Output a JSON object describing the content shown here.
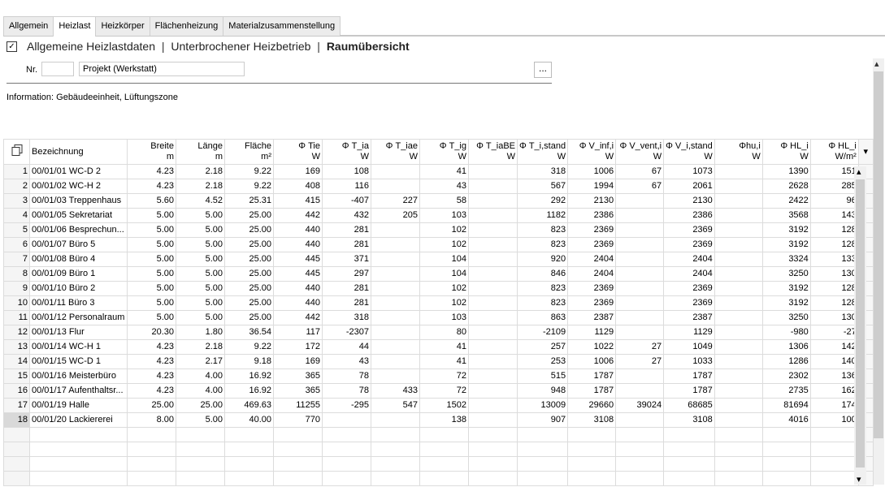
{
  "tabs": [
    {
      "label": "Allgemein",
      "active": false
    },
    {
      "label": "Heizlast",
      "active": true
    },
    {
      "label": "Heizkörper",
      "active": false
    },
    {
      "label": "Flächenheizung",
      "active": false
    },
    {
      "label": "Materialzusammenstellung",
      "active": false
    }
  ],
  "breadcrumb": {
    "item1": "Allgemeine Heizlastdaten",
    "item2": "Unterbrochener Heizbetrieb",
    "current": "Raumübersicht",
    "separator": "|",
    "checkbox": "✓"
  },
  "form": {
    "nr_label": "Nr.",
    "nr_value": "",
    "project_value": "Projekt (Werkstatt)",
    "dots_label": "..."
  },
  "info": "Information: Gebäudeeinheit, Lüftungszone",
  "icons": {
    "copy": "copy-icon",
    "scroll_up": "▴",
    "scroll_down": "▾",
    "menu_down": "▾"
  },
  "table": {
    "columns": [
      {
        "label": "Bezeichnung",
        "unit": ""
      },
      {
        "label": "Breite",
        "unit": "m"
      },
      {
        "label": "Länge",
        "unit": "m"
      },
      {
        "label": "Fläche",
        "unit": "m²"
      },
      {
        "label": "Φ Tie",
        "unit": "W"
      },
      {
        "label": "Φ T_ia",
        "unit": "W"
      },
      {
        "label": "Φ T_iae",
        "unit": "W"
      },
      {
        "label": "Φ T_ig",
        "unit": "W"
      },
      {
        "label": "Φ T_iaBE",
        "unit": "W"
      },
      {
        "label": "Φ T_i,stand",
        "unit": "W"
      },
      {
        "label": "Φ V_inf,i",
        "unit": "W"
      },
      {
        "label": "Φ V_vent,i",
        "unit": "W"
      },
      {
        "label": "Φ V_i,stand",
        "unit": "W"
      },
      {
        "label": "Φhu,i",
        "unit": "W"
      },
      {
        "label": "Φ HL_i",
        "unit": "W"
      },
      {
        "label": "Φ HL_i",
        "unit": "W/m²"
      }
    ],
    "rows": [
      [
        "1",
        "00/01/01 WC-D 2",
        "4.23",
        "2.18",
        "9.22",
        "169",
        "108",
        "",
        "41",
        "",
        "318",
        "1006",
        "67",
        "1073",
        "",
        "1390",
        "151"
      ],
      [
        "2",
        "00/01/02 WC-H 2",
        "4.23",
        "2.18",
        "9.22",
        "408",
        "116",
        "",
        "43",
        "",
        "567",
        "1994",
        "67",
        "2061",
        "",
        "2628",
        "285"
      ],
      [
        "3",
        "00/01/03 Treppenhaus",
        "5.60",
        "4.52",
        "25.31",
        "415",
        "-407",
        "227",
        "58",
        "",
        "292",
        "2130",
        "",
        "2130",
        "",
        "2422",
        "96"
      ],
      [
        "4",
        "00/01/05 Sekretariat",
        "5.00",
        "5.00",
        "25.00",
        "442",
        "432",
        "205",
        "103",
        "",
        "1182",
        "2386",
        "",
        "2386",
        "",
        "3568",
        "143"
      ],
      [
        "5",
        "00/01/06 Besprechun...",
        "5.00",
        "5.00",
        "25.00",
        "440",
        "281",
        "",
        "102",
        "",
        "823",
        "2369",
        "",
        "2369",
        "",
        "3192",
        "128"
      ],
      [
        "6",
        "00/01/07 Büro 5",
        "5.00",
        "5.00",
        "25.00",
        "440",
        "281",
        "",
        "102",
        "",
        "823",
        "2369",
        "",
        "2369",
        "",
        "3192",
        "128"
      ],
      [
        "7",
        "00/01/08 Büro 4",
        "5.00",
        "5.00",
        "25.00",
        "445",
        "371",
        "",
        "104",
        "",
        "920",
        "2404",
        "",
        "2404",
        "",
        "3324",
        "133"
      ],
      [
        "8",
        "00/01/09 Büro 1",
        "5.00",
        "5.00",
        "25.00",
        "445",
        "297",
        "",
        "104",
        "",
        "846",
        "2404",
        "",
        "2404",
        "",
        "3250",
        "130"
      ],
      [
        "9",
        "00/01/10 Büro 2",
        "5.00",
        "5.00",
        "25.00",
        "440",
        "281",
        "",
        "102",
        "",
        "823",
        "2369",
        "",
        "2369",
        "",
        "3192",
        "128"
      ],
      [
        "10",
        "00/01/11 Büro 3",
        "5.00",
        "5.00",
        "25.00",
        "440",
        "281",
        "",
        "102",
        "",
        "823",
        "2369",
        "",
        "2369",
        "",
        "3192",
        "128"
      ],
      [
        "11",
        "00/01/12 Personalraum",
        "5.00",
        "5.00",
        "25.00",
        "442",
        "318",
        "",
        "103",
        "",
        "863",
        "2387",
        "",
        "2387",
        "",
        "3250",
        "130"
      ],
      [
        "12",
        "00/01/13 Flur",
        "20.30",
        "1.80",
        "36.54",
        "117",
        "-2307",
        "",
        "80",
        "",
        "-2109",
        "1129",
        "",
        "1129",
        "",
        "-980",
        "-27"
      ],
      [
        "13",
        "00/01/14 WC-H 1",
        "4.23",
        "2.18",
        "9.22",
        "172",
        "44",
        "",
        "41",
        "",
        "257",
        "1022",
        "27",
        "1049",
        "",
        "1306",
        "142"
      ],
      [
        "14",
        "00/01/15 WC-D 1",
        "4.23",
        "2.17",
        "9.18",
        "169",
        "43",
        "",
        "41",
        "",
        "253",
        "1006",
        "27",
        "1033",
        "",
        "1286",
        "140"
      ],
      [
        "15",
        "00/01/16 Meisterbüro",
        "4.23",
        "4.00",
        "16.92",
        "365",
        "78",
        "",
        "72",
        "",
        "515",
        "1787",
        "",
        "1787",
        "",
        "2302",
        "136"
      ],
      [
        "16",
        "00/01/17 Aufenthaltsr...",
        "4.23",
        "4.00",
        "16.92",
        "365",
        "78",
        "433",
        "72",
        "",
        "948",
        "1787",
        "",
        "1787",
        "",
        "2735",
        "162"
      ],
      [
        "17",
        "00/01/19 Halle",
        "25.00",
        "25.00",
        "469.63",
        "11255",
        "-295",
        "547",
        "1502",
        "",
        "13009",
        "29660",
        "39024",
        "68685",
        "",
        "81694",
        "174"
      ],
      [
        "18",
        "00/01/20 Lackiererei",
        "8.00",
        "5.00",
        "40.00",
        "770",
        "",
        "",
        "138",
        "",
        "907",
        "3108",
        "",
        "3108",
        "",
        "4016",
        "100"
      ]
    ],
    "selected_row": 18
  }
}
